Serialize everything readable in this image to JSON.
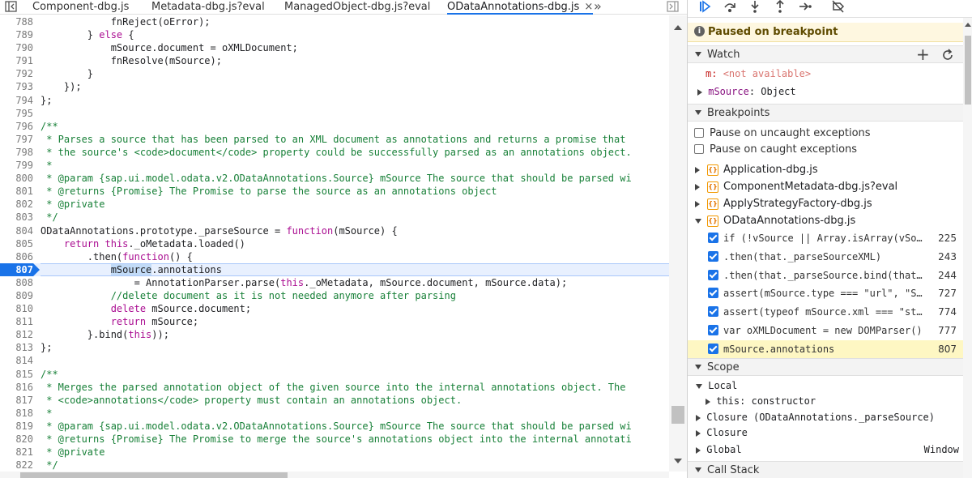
{
  "tabs": [
    {
      "label": "Component-dbg.js",
      "active": false
    },
    {
      "label": "Metadata-dbg.js?eval",
      "active": false
    },
    {
      "label": "ManagedObject-dbg.js?eval",
      "active": false
    },
    {
      "label": "ODataAnnotations-dbg.js",
      "active": true
    }
  ],
  "tab_close_glyph": "×",
  "more_tabs_glyph": "»",
  "editor": {
    "current_line": 807,
    "lines": [
      {
        "n": "788",
        "code": "            fnReject(oError);",
        "type": "plain"
      },
      {
        "n": "789",
        "code": "        } else {",
        "type": "plain"
      },
      {
        "n": "790",
        "code": "            mSource.document = oXMLDocument;",
        "type": "plain"
      },
      {
        "n": "791",
        "code": "            fnResolve(mSource);",
        "type": "plain"
      },
      {
        "n": "792",
        "code": "        }",
        "type": "plain"
      },
      {
        "n": "793",
        "code": "    });",
        "type": "plain"
      },
      {
        "n": "794",
        "code": "};",
        "type": "plain"
      },
      {
        "n": "795",
        "code": "",
        "type": "plain"
      },
      {
        "n": "796",
        "code": "/**",
        "type": "comment"
      },
      {
        "n": "797",
        "code": " * Parses a source that has been parsed to an XML document as annotations and returns a promise that",
        "type": "comment"
      },
      {
        "n": "798",
        "code": " * the source's <code>document</code> property could be successfully parsed as an annotations object.",
        "type": "comment"
      },
      {
        "n": "799",
        "code": " *",
        "type": "comment"
      },
      {
        "n": "800",
        "code": " * @param {sap.ui.model.odata.v2.ODataAnnotations.Source} mSource The source that should be parsed wi",
        "type": "comment"
      },
      {
        "n": "801",
        "code": " * @returns {Promise} The Promise to parse the source as an annotations object",
        "type": "comment"
      },
      {
        "n": "802",
        "code": " * @private",
        "type": "comment"
      },
      {
        "n": "803",
        "code": " */",
        "type": "comment"
      },
      {
        "n": "804",
        "code": "ODataAnnotations.prototype._parseSource = function(mSource) {",
        "type": "plain"
      },
      {
        "n": "805",
        "code": "    return this._oMetadata.loaded()",
        "type": "plain"
      },
      {
        "n": "806",
        "code": "        .then(function() {",
        "type": "plain"
      },
      {
        "n": "807",
        "code": "            mSource.annotations",
        "type": "current"
      },
      {
        "n": "808",
        "code": "                = AnnotationParser.parse(this._oMetadata, mSource.document, mSource.data);",
        "type": "plain"
      },
      {
        "n": "809",
        "code": "            //delete document as it is not needed anymore after parsing",
        "type": "comment"
      },
      {
        "n": "810",
        "code": "            delete mSource.document;",
        "type": "plain"
      },
      {
        "n": "811",
        "code": "            return mSource;",
        "type": "plain"
      },
      {
        "n": "812",
        "code": "        }.bind(this));",
        "type": "plain"
      },
      {
        "n": "813",
        "code": "};",
        "type": "plain"
      },
      {
        "n": "814",
        "code": "",
        "type": "plain"
      },
      {
        "n": "815",
        "code": "/**",
        "type": "comment"
      },
      {
        "n": "816",
        "code": " * Merges the parsed annotation object of the given source into the internal annotations object. The",
        "type": "comment"
      },
      {
        "n": "817",
        "code": " * <code>annotations</code> property must contain an annotations object.",
        "type": "comment"
      },
      {
        "n": "818",
        "code": " *",
        "type": "comment"
      },
      {
        "n": "819",
        "code": " * @param {sap.ui.model.odata.v2.ODataAnnotations.Source} mSource The source that should be parsed wi",
        "type": "comment"
      },
      {
        "n": "820",
        "code": " * @returns {Promise} The Promise to merge the source's annotations object into the internal annotati",
        "type": "comment"
      },
      {
        "n": "821",
        "code": " * @private",
        "type": "comment"
      },
      {
        "n": "822",
        "code": " */",
        "type": "comment"
      }
    ]
  },
  "sidebar": {
    "paused_text": "Paused on breakpoint",
    "watch": {
      "title": "Watch",
      "add_glyph": "+",
      "items": [
        {
          "name": "m",
          "value": "<not available>"
        },
        {
          "name": "mSource",
          "value": "Object"
        }
      ]
    },
    "breakpoints": {
      "title": "Breakpoints",
      "options": [
        "Pause on uncaught exceptions",
        "Pause on caught exceptions"
      ],
      "files": [
        {
          "name": "Application-dbg.js",
          "expanded": false
        },
        {
          "name": "ComponentMetadata-dbg.js?eval",
          "expanded": false
        },
        {
          "name": "ApplyStrategyFactory-dbg.js",
          "expanded": false
        },
        {
          "name": "ODataAnnotations-dbg.js",
          "expanded": true
        }
      ],
      "items": [
        {
          "code": "if (!vSource || Array.isArray(vSource",
          "line": "225"
        },
        {
          "code": ".then(that._parseSourceXML)",
          "line": "243"
        },
        {
          "code": ".then(that._parseSource.bind(that))",
          "line": "244"
        },
        {
          "code": "assert(mSource.type === \"url\", \"Source must be url\")",
          "line": "727"
        },
        {
          "code": "assert(typeof mSource.xml === \"string\")",
          "line": "774"
        },
        {
          "code": "var oXMLDocument = new DOMParser()",
          "line": "777"
        },
        {
          "code": "mSource.annotations",
          "line": "807"
        }
      ]
    },
    "scope": {
      "title": "Scope",
      "local": "Local",
      "this_label": "this",
      "this_value": "constructor",
      "closure1": "Closure (ODataAnnotations._parseSource)",
      "closure2": "Closure",
      "global": "Global",
      "global_value": "Window"
    },
    "call_stack": {
      "title": "Call Stack"
    }
  }
}
